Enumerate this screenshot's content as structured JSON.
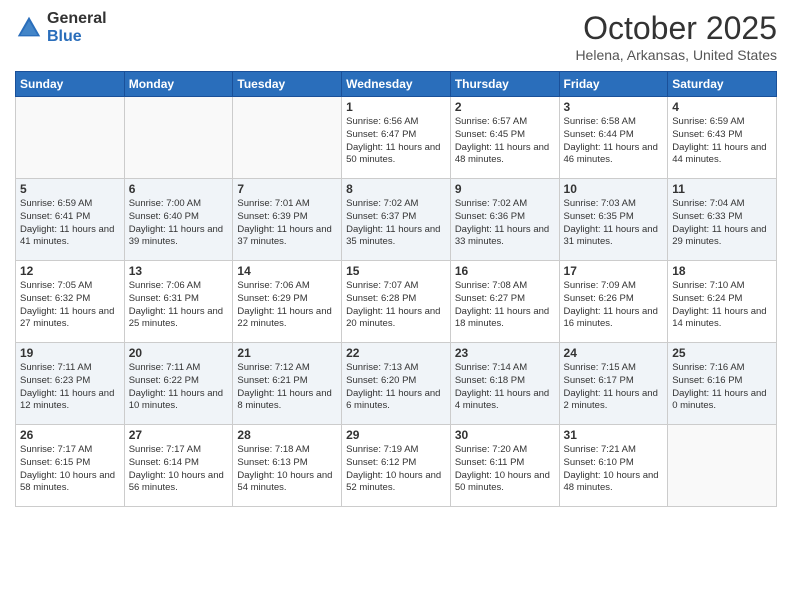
{
  "header": {
    "logo_general": "General",
    "logo_blue": "Blue",
    "title": "October 2025",
    "location": "Helena, Arkansas, United States"
  },
  "weekdays": [
    "Sunday",
    "Monday",
    "Tuesday",
    "Wednesday",
    "Thursday",
    "Friday",
    "Saturday"
  ],
  "weeks": [
    [
      {
        "day": "",
        "info": ""
      },
      {
        "day": "",
        "info": ""
      },
      {
        "day": "",
        "info": ""
      },
      {
        "day": "1",
        "info": "Sunrise: 6:56 AM\nSunset: 6:47 PM\nDaylight: 11 hours\nand 50 minutes."
      },
      {
        "day": "2",
        "info": "Sunrise: 6:57 AM\nSunset: 6:45 PM\nDaylight: 11 hours\nand 48 minutes."
      },
      {
        "day": "3",
        "info": "Sunrise: 6:58 AM\nSunset: 6:44 PM\nDaylight: 11 hours\nand 46 minutes."
      },
      {
        "day": "4",
        "info": "Sunrise: 6:59 AM\nSunset: 6:43 PM\nDaylight: 11 hours\nand 44 minutes."
      }
    ],
    [
      {
        "day": "5",
        "info": "Sunrise: 6:59 AM\nSunset: 6:41 PM\nDaylight: 11 hours\nand 41 minutes."
      },
      {
        "day": "6",
        "info": "Sunrise: 7:00 AM\nSunset: 6:40 PM\nDaylight: 11 hours\nand 39 minutes."
      },
      {
        "day": "7",
        "info": "Sunrise: 7:01 AM\nSunset: 6:39 PM\nDaylight: 11 hours\nand 37 minutes."
      },
      {
        "day": "8",
        "info": "Sunrise: 7:02 AM\nSunset: 6:37 PM\nDaylight: 11 hours\nand 35 minutes."
      },
      {
        "day": "9",
        "info": "Sunrise: 7:02 AM\nSunset: 6:36 PM\nDaylight: 11 hours\nand 33 minutes."
      },
      {
        "day": "10",
        "info": "Sunrise: 7:03 AM\nSunset: 6:35 PM\nDaylight: 11 hours\nand 31 minutes."
      },
      {
        "day": "11",
        "info": "Sunrise: 7:04 AM\nSunset: 6:33 PM\nDaylight: 11 hours\nand 29 minutes."
      }
    ],
    [
      {
        "day": "12",
        "info": "Sunrise: 7:05 AM\nSunset: 6:32 PM\nDaylight: 11 hours\nand 27 minutes."
      },
      {
        "day": "13",
        "info": "Sunrise: 7:06 AM\nSunset: 6:31 PM\nDaylight: 11 hours\nand 25 minutes."
      },
      {
        "day": "14",
        "info": "Sunrise: 7:06 AM\nSunset: 6:29 PM\nDaylight: 11 hours\nand 22 minutes."
      },
      {
        "day": "15",
        "info": "Sunrise: 7:07 AM\nSunset: 6:28 PM\nDaylight: 11 hours\nand 20 minutes."
      },
      {
        "day": "16",
        "info": "Sunrise: 7:08 AM\nSunset: 6:27 PM\nDaylight: 11 hours\nand 18 minutes."
      },
      {
        "day": "17",
        "info": "Sunrise: 7:09 AM\nSunset: 6:26 PM\nDaylight: 11 hours\nand 16 minutes."
      },
      {
        "day": "18",
        "info": "Sunrise: 7:10 AM\nSunset: 6:24 PM\nDaylight: 11 hours\nand 14 minutes."
      }
    ],
    [
      {
        "day": "19",
        "info": "Sunrise: 7:11 AM\nSunset: 6:23 PM\nDaylight: 11 hours\nand 12 minutes."
      },
      {
        "day": "20",
        "info": "Sunrise: 7:11 AM\nSunset: 6:22 PM\nDaylight: 11 hours\nand 10 minutes."
      },
      {
        "day": "21",
        "info": "Sunrise: 7:12 AM\nSunset: 6:21 PM\nDaylight: 11 hours\nand 8 minutes."
      },
      {
        "day": "22",
        "info": "Sunrise: 7:13 AM\nSunset: 6:20 PM\nDaylight: 11 hours\nand 6 minutes."
      },
      {
        "day": "23",
        "info": "Sunrise: 7:14 AM\nSunset: 6:18 PM\nDaylight: 11 hours\nand 4 minutes."
      },
      {
        "day": "24",
        "info": "Sunrise: 7:15 AM\nSunset: 6:17 PM\nDaylight: 11 hours\nand 2 minutes."
      },
      {
        "day": "25",
        "info": "Sunrise: 7:16 AM\nSunset: 6:16 PM\nDaylight: 11 hours\nand 0 minutes."
      }
    ],
    [
      {
        "day": "26",
        "info": "Sunrise: 7:17 AM\nSunset: 6:15 PM\nDaylight: 10 hours\nand 58 minutes."
      },
      {
        "day": "27",
        "info": "Sunrise: 7:17 AM\nSunset: 6:14 PM\nDaylight: 10 hours\nand 56 minutes."
      },
      {
        "day": "28",
        "info": "Sunrise: 7:18 AM\nSunset: 6:13 PM\nDaylight: 10 hours\nand 54 minutes."
      },
      {
        "day": "29",
        "info": "Sunrise: 7:19 AM\nSunset: 6:12 PM\nDaylight: 10 hours\nand 52 minutes."
      },
      {
        "day": "30",
        "info": "Sunrise: 7:20 AM\nSunset: 6:11 PM\nDaylight: 10 hours\nand 50 minutes."
      },
      {
        "day": "31",
        "info": "Sunrise: 7:21 AM\nSunset: 6:10 PM\nDaylight: 10 hours\nand 48 minutes."
      },
      {
        "day": "",
        "info": ""
      }
    ]
  ]
}
